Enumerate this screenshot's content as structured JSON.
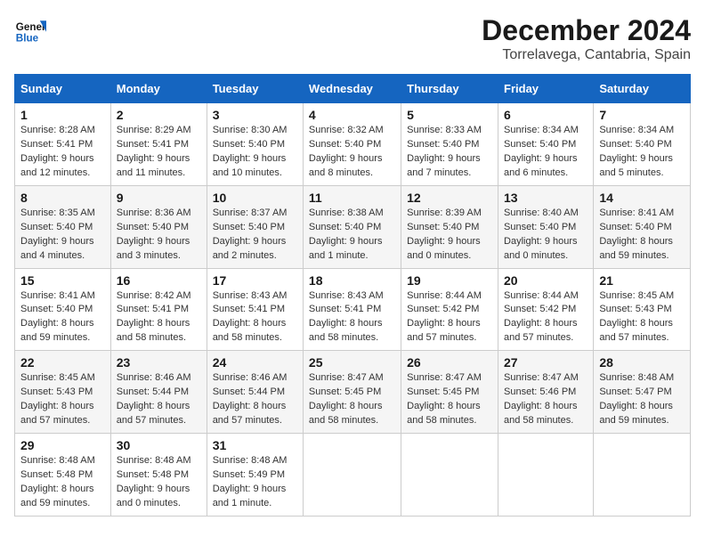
{
  "logo": {
    "line1": "General",
    "line2": "Blue"
  },
  "title": "December 2024",
  "location": "Torrelavega, Cantabria, Spain",
  "days_of_week": [
    "Sunday",
    "Monday",
    "Tuesday",
    "Wednesday",
    "Thursday",
    "Friday",
    "Saturday"
  ],
  "weeks": [
    [
      {
        "day": "1",
        "info": "Sunrise: 8:28 AM\nSunset: 5:41 PM\nDaylight: 9 hours\nand 12 minutes."
      },
      {
        "day": "2",
        "info": "Sunrise: 8:29 AM\nSunset: 5:41 PM\nDaylight: 9 hours\nand 11 minutes."
      },
      {
        "day": "3",
        "info": "Sunrise: 8:30 AM\nSunset: 5:40 PM\nDaylight: 9 hours\nand 10 minutes."
      },
      {
        "day": "4",
        "info": "Sunrise: 8:32 AM\nSunset: 5:40 PM\nDaylight: 9 hours\nand 8 minutes."
      },
      {
        "day": "5",
        "info": "Sunrise: 8:33 AM\nSunset: 5:40 PM\nDaylight: 9 hours\nand 7 minutes."
      },
      {
        "day": "6",
        "info": "Sunrise: 8:34 AM\nSunset: 5:40 PM\nDaylight: 9 hours\nand 6 minutes."
      },
      {
        "day": "7",
        "info": "Sunrise: 8:34 AM\nSunset: 5:40 PM\nDaylight: 9 hours\nand 5 minutes."
      }
    ],
    [
      {
        "day": "8",
        "info": "Sunrise: 8:35 AM\nSunset: 5:40 PM\nDaylight: 9 hours\nand 4 minutes."
      },
      {
        "day": "9",
        "info": "Sunrise: 8:36 AM\nSunset: 5:40 PM\nDaylight: 9 hours\nand 3 minutes."
      },
      {
        "day": "10",
        "info": "Sunrise: 8:37 AM\nSunset: 5:40 PM\nDaylight: 9 hours\nand 2 minutes."
      },
      {
        "day": "11",
        "info": "Sunrise: 8:38 AM\nSunset: 5:40 PM\nDaylight: 9 hours\nand 1 minute."
      },
      {
        "day": "12",
        "info": "Sunrise: 8:39 AM\nSunset: 5:40 PM\nDaylight: 9 hours\nand 0 minutes."
      },
      {
        "day": "13",
        "info": "Sunrise: 8:40 AM\nSunset: 5:40 PM\nDaylight: 9 hours\nand 0 minutes."
      },
      {
        "day": "14",
        "info": "Sunrise: 8:41 AM\nSunset: 5:40 PM\nDaylight: 8 hours\nand 59 minutes."
      }
    ],
    [
      {
        "day": "15",
        "info": "Sunrise: 8:41 AM\nSunset: 5:40 PM\nDaylight: 8 hours\nand 59 minutes."
      },
      {
        "day": "16",
        "info": "Sunrise: 8:42 AM\nSunset: 5:41 PM\nDaylight: 8 hours\nand 58 minutes."
      },
      {
        "day": "17",
        "info": "Sunrise: 8:43 AM\nSunset: 5:41 PM\nDaylight: 8 hours\nand 58 minutes."
      },
      {
        "day": "18",
        "info": "Sunrise: 8:43 AM\nSunset: 5:41 PM\nDaylight: 8 hours\nand 58 minutes."
      },
      {
        "day": "19",
        "info": "Sunrise: 8:44 AM\nSunset: 5:42 PM\nDaylight: 8 hours\nand 57 minutes."
      },
      {
        "day": "20",
        "info": "Sunrise: 8:44 AM\nSunset: 5:42 PM\nDaylight: 8 hours\nand 57 minutes."
      },
      {
        "day": "21",
        "info": "Sunrise: 8:45 AM\nSunset: 5:43 PM\nDaylight: 8 hours\nand 57 minutes."
      }
    ],
    [
      {
        "day": "22",
        "info": "Sunrise: 8:45 AM\nSunset: 5:43 PM\nDaylight: 8 hours\nand 57 minutes."
      },
      {
        "day": "23",
        "info": "Sunrise: 8:46 AM\nSunset: 5:44 PM\nDaylight: 8 hours\nand 57 minutes."
      },
      {
        "day": "24",
        "info": "Sunrise: 8:46 AM\nSunset: 5:44 PM\nDaylight: 8 hours\nand 57 minutes."
      },
      {
        "day": "25",
        "info": "Sunrise: 8:47 AM\nSunset: 5:45 PM\nDaylight: 8 hours\nand 58 minutes."
      },
      {
        "day": "26",
        "info": "Sunrise: 8:47 AM\nSunset: 5:45 PM\nDaylight: 8 hours\nand 58 minutes."
      },
      {
        "day": "27",
        "info": "Sunrise: 8:47 AM\nSunset: 5:46 PM\nDaylight: 8 hours\nand 58 minutes."
      },
      {
        "day": "28",
        "info": "Sunrise: 8:48 AM\nSunset: 5:47 PM\nDaylight: 8 hours\nand 59 minutes."
      }
    ],
    [
      {
        "day": "29",
        "info": "Sunrise: 8:48 AM\nSunset: 5:48 PM\nDaylight: 8 hours\nand 59 minutes."
      },
      {
        "day": "30",
        "info": "Sunrise: 8:48 AM\nSunset: 5:48 PM\nDaylight: 9 hours\nand 0 minutes."
      },
      {
        "day": "31",
        "info": "Sunrise: 8:48 AM\nSunset: 5:49 PM\nDaylight: 9 hours\nand 1 minute."
      },
      {
        "day": "",
        "info": ""
      },
      {
        "day": "",
        "info": ""
      },
      {
        "day": "",
        "info": ""
      },
      {
        "day": "",
        "info": ""
      }
    ]
  ]
}
